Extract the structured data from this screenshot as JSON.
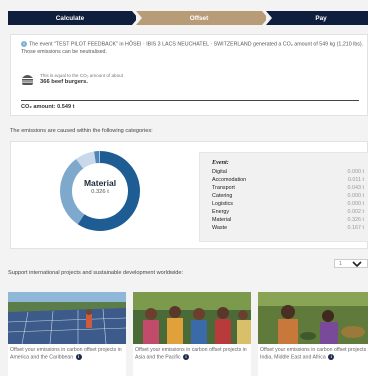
{
  "steps": [
    "Calculate",
    "Offset",
    "Pay"
  ],
  "info": {
    "sentence": "The event \"TEST PILOT FEEDBACK\" in HÔSEI · IBIS 3 LACS NEUCHATEL · SWITZERLAND generated a CO₂ amount of 549 kg (1,210 lbs). Those emissions can be neutralised.",
    "burger_small": "This is equal to the CO₂ amount of about",
    "burger_big": "366 beef burgers.",
    "co2_label": "CO₂ amount:",
    "co2_value": "0.549 t"
  },
  "causes_title": "The emissions are caused within the following categories:",
  "donut": {
    "name": "Material",
    "value": "0.326 t"
  },
  "table": {
    "heading": "Event:",
    "rows": [
      {
        "label": "Digital",
        "value": "0.000 t"
      },
      {
        "label": "Accomodation",
        "value": "0.011 t"
      },
      {
        "label": "Transport",
        "value": "0.043 t"
      },
      {
        "label": "Catering",
        "value": "0.000 t"
      },
      {
        "label": "Logistics",
        "value": "0.000 t"
      },
      {
        "label": "Energy",
        "value": "0.002 t"
      },
      {
        "label": "Material",
        "value": "0.326 t"
      },
      {
        "label": "Waste",
        "value": "0.167 t"
      }
    ]
  },
  "donut_shares": [
    {
      "category": "Material",
      "value": 0.326,
      "color": "#1d5d94"
    },
    {
      "category": "Waste",
      "value": 0.167,
      "color": "#7fa9cc"
    },
    {
      "category": "Transport",
      "value": 0.043,
      "color": "#c7d9ea"
    },
    {
      "category": "Accomodation",
      "value": 0.011,
      "color": "#4f86b6"
    },
    {
      "category": "Energy",
      "value": 0.002,
      "color": "#a9c4dd"
    }
  ],
  "support_title": "Support international projects and sustainable development worldwide:",
  "dropdown": {
    "value": "1"
  },
  "cards": [
    {
      "text": "Offset your emissions in carbon offset projects in America and the Caribbean"
    },
    {
      "text": "Offset your emissions in carbon offset projects in Asia and the Pacific"
    },
    {
      "text": "Offset your emissions in carbon offset projects in India, Middle East and Africa"
    }
  ],
  "icons": {
    "info": "info-icon",
    "burger": "burger-icon",
    "chevron": "chevron-down-icon"
  }
}
